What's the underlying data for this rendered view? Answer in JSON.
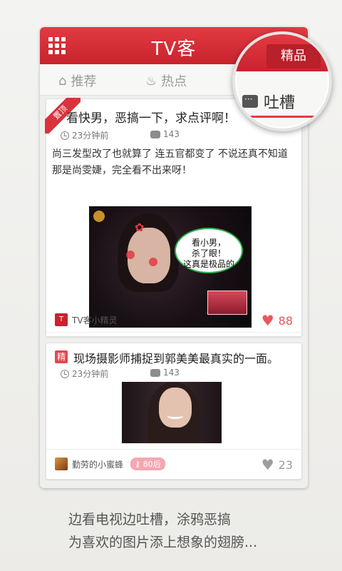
{
  "header": {
    "title": "TV客"
  },
  "tabs": [
    {
      "label": "推荐"
    },
    {
      "label": "热点"
    }
  ],
  "magnifier": {
    "premium_label": "精品",
    "roast_label": "吐槽"
  },
  "posts": [
    {
      "badge": "置顶",
      "title": "看快男，恶搞一下，求点评啊！",
      "time": "23分钟前",
      "comments": "143",
      "text": "尚三发型改了也就算了 连五官都变了 不说还真不知道那是尚雯婕，完全看不出来呀！",
      "speech_bubble": "看小男，\n杀了眼！\n这真是极品的",
      "author": "TV客小精灵",
      "author_icon": "T",
      "likes": "88"
    },
    {
      "badge": "精",
      "title": "现场摄影师捕捉到郭美美最真实的一面。",
      "time": "23分钟前",
      "comments": "143",
      "author": "勤劳的小蜜蜂",
      "age_tag": "80后",
      "likes": "23"
    }
  ],
  "slogan": {
    "line1": "边看电视边吐槽，涂鸦恶搞",
    "line2": "为喜欢的图片添上想象的翅膀..."
  },
  "colors": {
    "brand_red": "#d9333d",
    "heart_red": "#e65a5a",
    "heart_grey": "#9c9c9c"
  }
}
